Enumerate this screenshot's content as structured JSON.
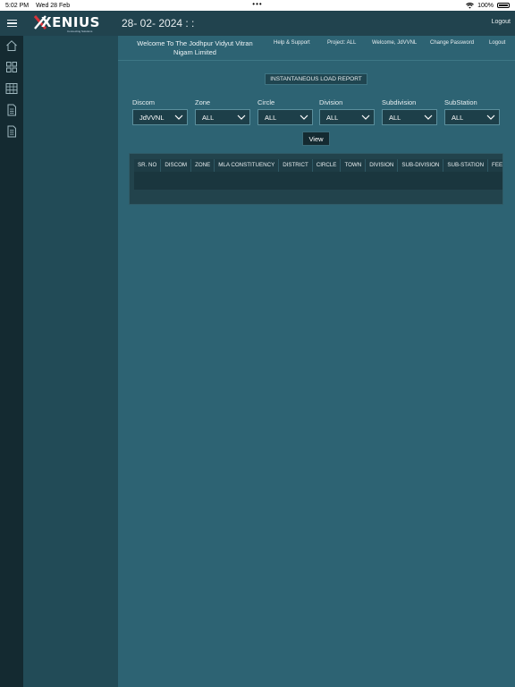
{
  "status_bar": {
    "time": "5:02 PM",
    "date": "Wed 28 Feb",
    "battery": "100%",
    "dots": "•••"
  },
  "header": {
    "logo": "XENIUS",
    "logo_tagline": "Connecting Solutions",
    "datetime": "28- 02- 2024 : :",
    "logout": "Logout"
  },
  "subheader": {
    "welcome": "Welcome To The Jodhpur Vidyut Vitran Nigam Limited",
    "links": [
      "Help & Support",
      "Project: ALL",
      "Welcome, JdVVNL",
      "Change Password",
      "Logout"
    ]
  },
  "report": {
    "title": "INSTANTANEOUS LOAD REPORT",
    "filters": [
      {
        "label": "Discom",
        "value": "JdVVNL"
      },
      {
        "label": "Zone",
        "value": "ALL"
      },
      {
        "label": "Circle",
        "value": "ALL"
      },
      {
        "label": "Division",
        "value": "ALL"
      },
      {
        "label": "Subdivision",
        "value": "ALL"
      },
      {
        "label": "SubStation",
        "value": "ALL"
      }
    ],
    "view_button": "View",
    "table_headers": [
      "SR. NO",
      "DISCOM",
      "ZONE",
      "MLA CONSTITUENCY",
      "DISTRICT",
      "CIRCLE",
      "TOWN",
      "DIVISION",
      "SUB-DIVISION",
      "SUB-STATION",
      "FEE"
    ]
  },
  "rail_icons": [
    "home-icon",
    "grid-icon",
    "table-icon",
    "document-icon",
    "report-icon"
  ],
  "colors": {
    "background": "#2d6373",
    "header": "#21434e",
    "rail": "#142a31",
    "sidebar": "#224b57"
  }
}
